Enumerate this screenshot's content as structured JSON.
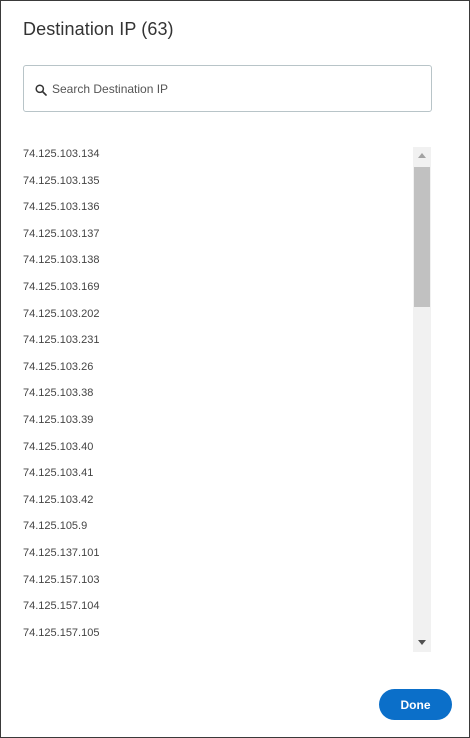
{
  "dialog": {
    "title": "Destination IP (63)"
  },
  "search": {
    "placeholder": "Search Destination IP",
    "value": "",
    "icon": "search-icon"
  },
  "list": {
    "items": [
      "74.125.103.134",
      "74.125.103.135",
      "74.125.103.136",
      "74.125.103.137",
      "74.125.103.138",
      "74.125.103.169",
      "74.125.103.202",
      "74.125.103.231",
      "74.125.103.26",
      "74.125.103.38",
      "74.125.103.39",
      "74.125.103.40",
      "74.125.103.41",
      "74.125.103.42",
      "74.125.105.9",
      "74.125.137.101",
      "74.125.157.103",
      "74.125.157.104",
      "74.125.157.105"
    ]
  },
  "footer": {
    "done_label": "Done"
  },
  "colors": {
    "accent": "#0b6fc9",
    "border": "#b8c4c8",
    "text": "#333333"
  }
}
